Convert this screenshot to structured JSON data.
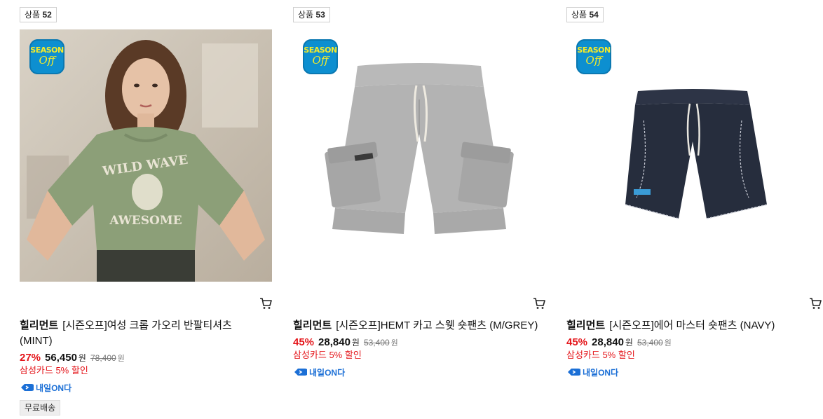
{
  "products": [
    {
      "badge_label": "상품",
      "badge_num": "52",
      "season_top": "SEASON",
      "season_bottom": "Off",
      "brand": "힐리먼트",
      "name": "[시즌오프]여성 크롭 가오리 반팔티셔츠 (MINT)",
      "discount_rate": "27%",
      "price": "56,450",
      "price_unit": "원",
      "original_price": "78,400",
      "original_unit": "원",
      "card_discount": "삼성카드 5% 할인",
      "delivery_badge": "내일ON다",
      "shipping_tag": "무료배송",
      "image_icon": "model-tshirt-photo"
    },
    {
      "badge_label": "상품",
      "badge_num": "53",
      "season_top": "SEASON",
      "season_bottom": "Off",
      "brand": "힐리먼트",
      "name": "[시즌오프]HEMT 카고 스웻 숏팬츠 (M/GREY)",
      "discount_rate": "45%",
      "price": "28,840",
      "price_unit": "원",
      "original_price": "53,400",
      "original_unit": "원",
      "card_discount": "삼성카드 5% 할인",
      "delivery_badge": "내일ON다",
      "image_icon": "grey-shorts-photo"
    },
    {
      "badge_label": "상품",
      "badge_num": "54",
      "season_top": "SEASON",
      "season_bottom": "Off",
      "brand": "힐리먼트",
      "name": "[시즌오프]에어 마스터 숏팬츠 (NAVY)",
      "discount_rate": "45%",
      "price": "28,840",
      "price_unit": "원",
      "original_price": "53,400",
      "original_unit": "원",
      "card_discount": "삼성카드 5% 할인",
      "delivery_badge": "내일ON다",
      "image_icon": "navy-shorts-photo"
    }
  ],
  "icons": {
    "cart": "cart-icon",
    "delivery": "delivery-rocket-icon"
  },
  "colors": {
    "discount_red": "#e4151a",
    "delivery_blue": "#1b6fd6",
    "season_blue": "#0d8fd0",
    "season_yellow": "#f4ea2a"
  }
}
